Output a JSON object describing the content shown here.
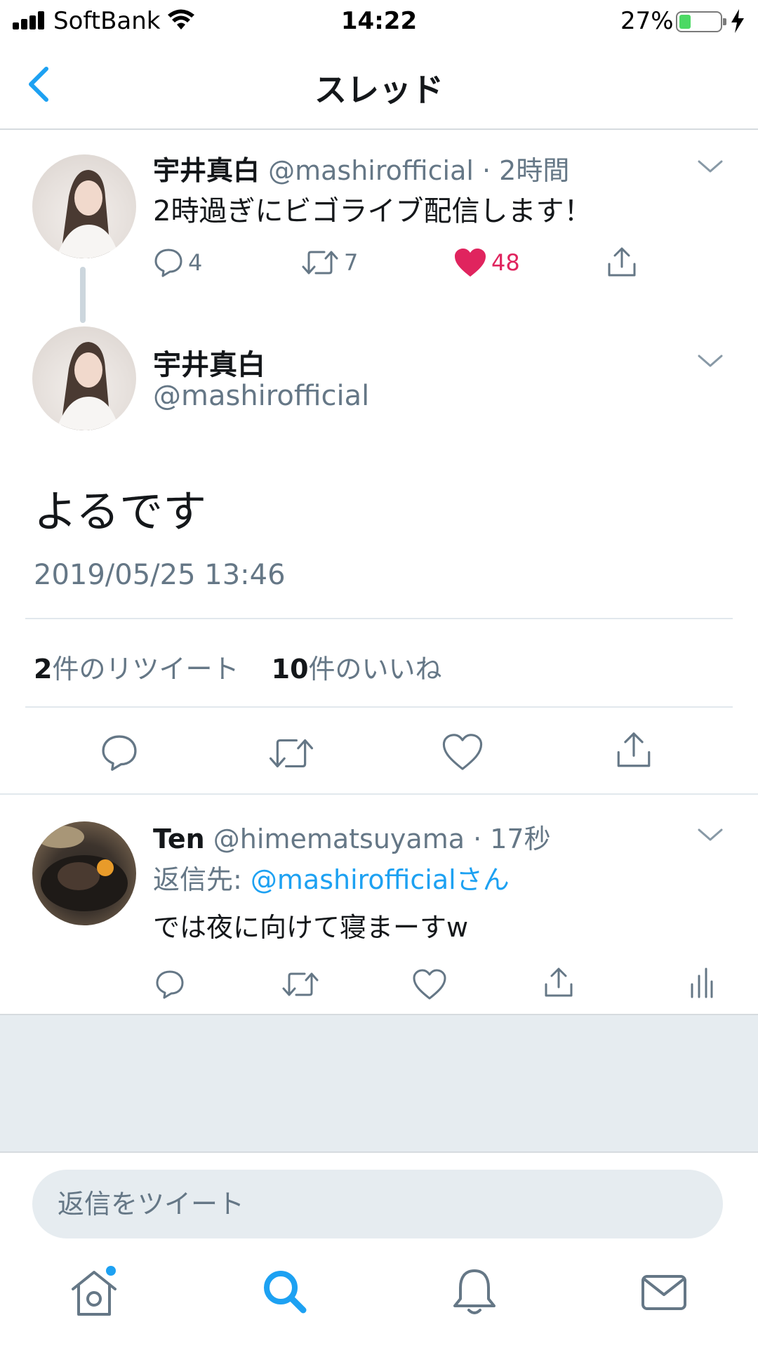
{
  "status_bar": {
    "carrier": "SoftBank",
    "time": "14:22",
    "battery_text": "27%",
    "battery_level": 0.27
  },
  "nav": {
    "title": "スレッド"
  },
  "colors": {
    "accent": "#1da1f2",
    "like": "#e0245e",
    "muted": "#657786",
    "text": "#14171a",
    "composer_bg": "#e6ecf0"
  },
  "parent_tweet": {
    "name": "宇井真白",
    "handle": "@mashirofficial",
    "time": "· 2時間",
    "text": "2時過ぎにビゴライブ配信します！",
    "reply_count": "4",
    "retweet_count": "7",
    "like_count": "48",
    "liked": true
  },
  "focus_tweet": {
    "name": "宇井真白",
    "handle": "@mashirofficial",
    "text": "よるです",
    "timestamp": "2019/05/25 13:46",
    "retweet_num": "2",
    "retweet_label": "件のリツイート",
    "like_num": "10",
    "like_label": "件のいいね"
  },
  "reply_tweet": {
    "name": "Ten",
    "handle": "@himematsuyama",
    "time": "· 17秒",
    "reply_to_prefix": "返信先: ",
    "reply_to_handle": "@mashirofficialさん",
    "text": "では夜に向けて寝まーすw"
  },
  "composer": {
    "placeholder": "返信をツイート"
  },
  "tab_bar": {
    "items": [
      "home-icon",
      "search-icon",
      "notifications-icon",
      "messages-icon"
    ],
    "active": "search-icon"
  }
}
